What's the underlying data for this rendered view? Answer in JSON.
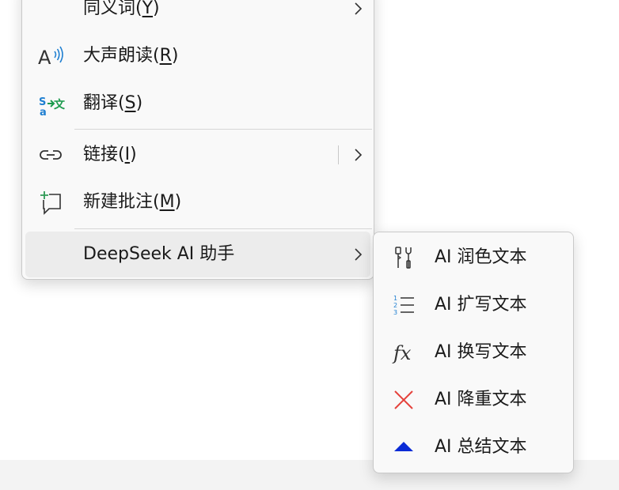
{
  "context_menu": {
    "items": [
      {
        "label": "同义词(",
        "key": "Y",
        "suffix": ")",
        "icon": "none",
        "has_submenu": true
      },
      {
        "label": "大声朗读(",
        "key": "R",
        "suffix": ")",
        "icon": "read-aloud-icon",
        "has_submenu": false
      },
      {
        "label": "翻译(",
        "key": "S",
        "suffix": ")",
        "icon": "translate-icon",
        "has_submenu": false
      },
      {
        "label": "链接(",
        "key": "I",
        "suffix": ")",
        "icon": "link-icon",
        "has_submenu": true
      },
      {
        "label": "新建批注(",
        "key": "M",
        "suffix": ")",
        "icon": "new-comment-icon",
        "has_submenu": false
      },
      {
        "label": "DeepSeek AI 助手",
        "icon": "none",
        "has_submenu": true,
        "highlighted": true
      }
    ]
  },
  "submenu": {
    "items": [
      {
        "label": "AI 润色文本",
        "icon": "tools-icon"
      },
      {
        "label": "AI 扩写文本",
        "icon": "numbered-list-icon"
      },
      {
        "label": "AI 换写文本",
        "icon": "function-fx-icon"
      },
      {
        "label": "AI 降重文本",
        "icon": "red-x-icon"
      },
      {
        "label": "AI 总结文本",
        "icon": "blue-triangle-icon"
      }
    ]
  },
  "colors": {
    "menu_bg": "#f9f9f9",
    "highlight_bg": "#ececec",
    "translate_blue": "#1f7fd1",
    "translate_green": "#1b9a4c",
    "comment_green": "#2f9a56",
    "x_red": "#e5413b",
    "triangle_blue": "#0a2bd6",
    "list_blue": "#1f7fd1"
  }
}
